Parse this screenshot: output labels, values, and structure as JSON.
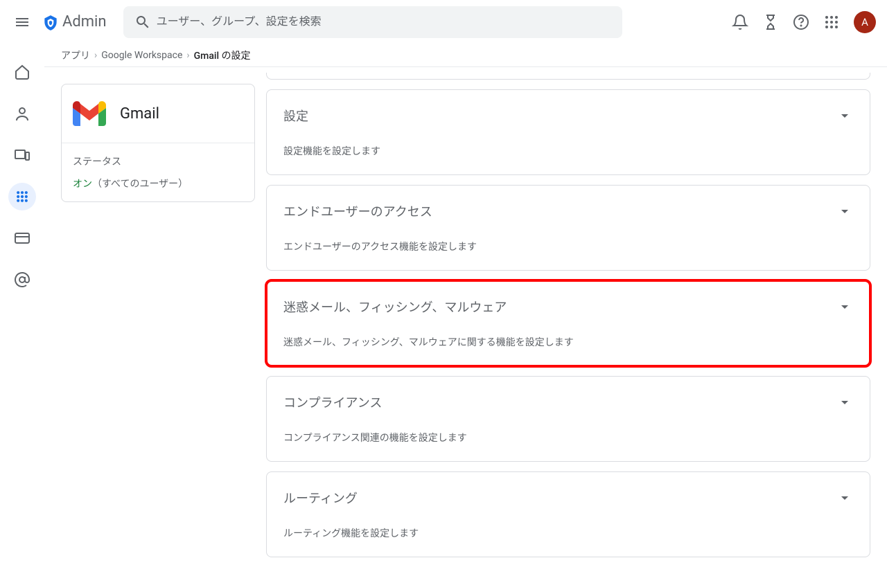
{
  "header": {
    "logo_text": "Admin",
    "search_placeholder": "ユーザー、グループ、設定を検索",
    "avatar_letter": "A"
  },
  "breadcrumb": {
    "items": [
      "アプリ",
      "Google Workspace"
    ],
    "current": "Gmail の設定"
  },
  "left_panel": {
    "app_name": "Gmail",
    "status_label": "ステータス",
    "status_on": "オン",
    "status_extra": "（すべてのユーザー）"
  },
  "sections": [
    {
      "title": "設定",
      "desc": "設定機能を設定します",
      "highlighted": false
    },
    {
      "title": "エンドユーザーのアクセス",
      "desc": "エンドユーザーのアクセス機能を設定します",
      "highlighted": false
    },
    {
      "title": "迷惑メール、フィッシング、マルウェア",
      "desc": "迷惑メール、フィッシング、マルウェアに関する機能を設定します",
      "highlighted": true
    },
    {
      "title": "コンプライアンス",
      "desc": "コンプライアンス関連の機能を設定します",
      "highlighted": false
    },
    {
      "title": "ルーティング",
      "desc": "ルーティング機能を設定します",
      "highlighted": false
    }
  ]
}
